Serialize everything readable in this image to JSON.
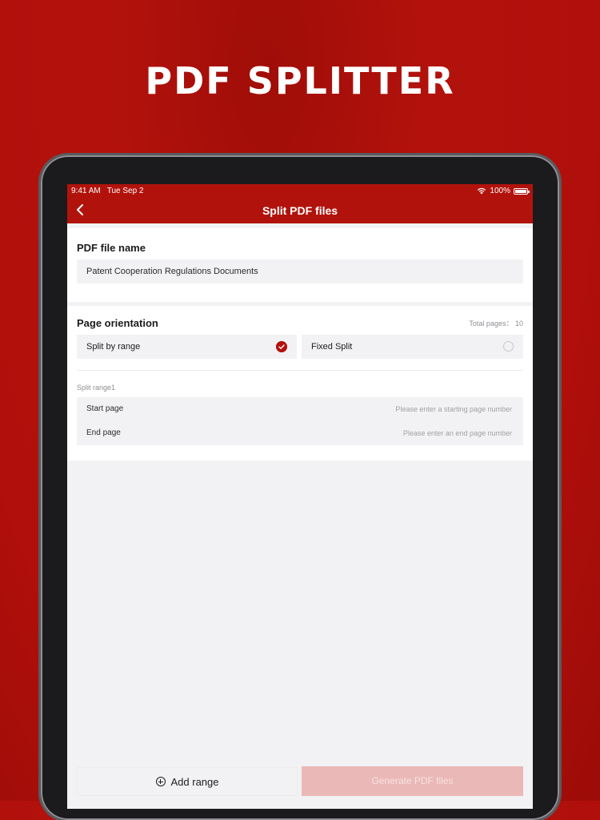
{
  "hero": {
    "title": "PDF SPLITTER"
  },
  "status_bar": {
    "time": "9:41 AM",
    "date": "Tue Sep 2",
    "battery": "100%"
  },
  "header": {
    "title": "Split PDF files"
  },
  "file_section": {
    "label": "PDF file name",
    "value": "Patent Cooperation Regulations Documents"
  },
  "orientation_section": {
    "label": "Page orientation",
    "total_pages_label": "Total pages：",
    "total_pages": "10",
    "options": [
      {
        "label": "Split by range",
        "selected": true
      },
      {
        "label": "Fixed Split",
        "selected": false
      }
    ]
  },
  "split_range": {
    "label": "Split range1",
    "start_label": "Start page",
    "start_placeholder": "Please enter a starting page number",
    "end_label": "End page",
    "end_placeholder": "Please enter an end page number"
  },
  "actions": {
    "add_range": "Add range",
    "generate": "Generate PDF files"
  },
  "colors": {
    "accent": "#b1130c",
    "generate_disabled": "#eab8b6",
    "page_bg": "#b3120c"
  }
}
